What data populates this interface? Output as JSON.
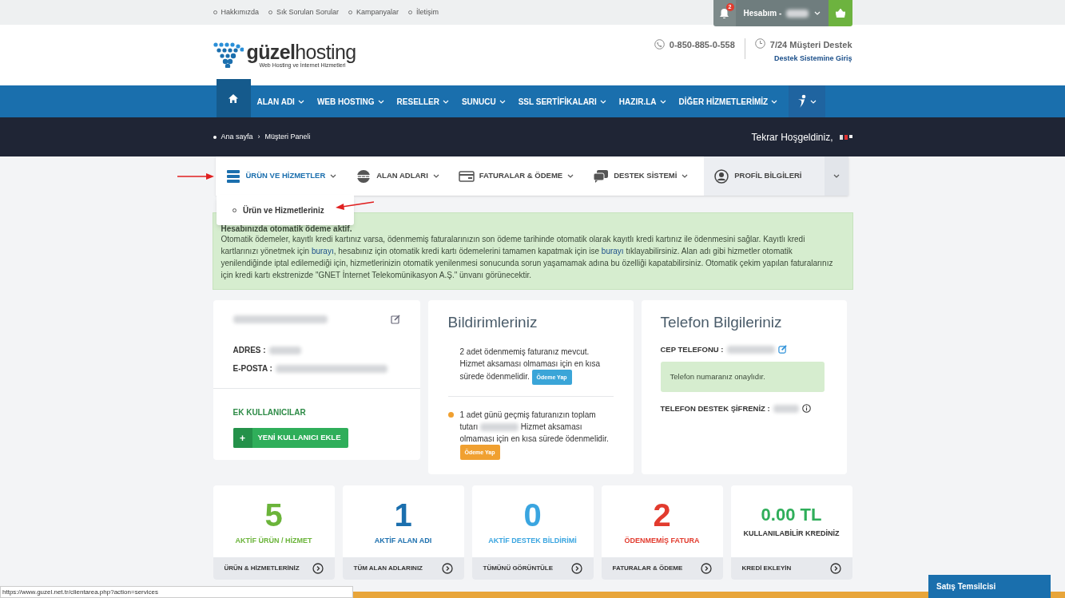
{
  "top_links": [
    "Hakkımızda",
    "Sık Sorulan Sorular",
    "Kampanyalar",
    "İletişim"
  ],
  "account": {
    "notification_count": "2",
    "label": "Hesabım -"
  },
  "logo": {
    "part1": "güzel",
    "part2": "hosting",
    "tagline": "Web Hosting ve İnternet Hizmetleri"
  },
  "contact": {
    "phone": "0-850-885-0-558",
    "support_title": "7/24 Müşteri Destek",
    "support_link": "Destek Sistemine Giriş"
  },
  "nav": [
    {
      "kind": "home",
      "selected": true
    },
    {
      "kind": "text",
      "label": "ALAN ADI",
      "selected": false
    },
    {
      "kind": "text",
      "label": "WEB HOSTING",
      "selected": false
    },
    {
      "kind": "text",
      "label": "RESELLER",
      "selected": false
    },
    {
      "kind": "text",
      "label": "SUNUCU",
      "selected": false
    },
    {
      "kind": "text",
      "label": "SSL SERTİFİKALARI",
      "selected": false
    },
    {
      "kind": "text",
      "label": "HAZIR.LA",
      "selected": false
    },
    {
      "kind": "text",
      "label": "DİĞER HİZMETLERİMİZ",
      "selected": false
    },
    {
      "kind": "figure",
      "selected": false
    }
  ],
  "breadcrumb": [
    "Ana sayfa",
    "Müşteri Paneli"
  ],
  "breadcrumb_separator": "›",
  "welcome": "Tekrar Hoşgeldiniz,",
  "panel_tabs": [
    {
      "kind": "services",
      "label": "ÜRÜN VE HİZMETLER",
      "selected": true
    },
    {
      "kind": "domains",
      "label": "ALAN ADLARI",
      "selected": false
    },
    {
      "kind": "billing",
      "label": "FATURALAR & ÖDEME",
      "selected": false
    },
    {
      "kind": "support",
      "label": "DESTEK SİSTEMİ",
      "selected": false
    },
    {
      "kind": "profile",
      "label": "PROFİL BİLGİLERİ",
      "selected": false
    }
  ],
  "dropdown": [
    "Ürün ve Hizmetleriniz"
  ],
  "alert": {
    "title": "Hesabınızda otomatik ödeme aktif.",
    "segments": [
      {
        "kind": "text",
        "text": "Otomatik ödemeler, kayıtlı kredi kartınız varsa, ödenmemiş faturalarınızın son ödeme tarihinde otomatik olarak kayıtlı kredi kartınız ile ödenmesini sağlar. Kayıtlı kredi kartlarınızı yönetmek için "
      },
      {
        "kind": "link",
        "text": "burayı"
      },
      {
        "kind": "text",
        "text": ", hesabınız için otomatik kredi kartı ödemelerini tamamen kapatmak için ise "
      },
      {
        "kind": "link",
        "text": "burayı"
      },
      {
        "kind": "text",
        "text": " tıklayabilirsiniz. Alan adı gibi hizmetler otomatik yenilendiğinde iptal edilemediği için, hizmetlerinizin otomatik yenilenmesi sonucunda sorun yaşamamak adına bu özelliği kapatabilirsiniz. Otomatik çekim yapılan faturalarınız için kredi kartı ekstrenizde \"GNET İnternet Telekomünikasyon A.Ş.\" ünvanı görünecektir."
      }
    ]
  },
  "profile": {
    "address_label": "ADRES :",
    "email_label": "E-POSTA :",
    "extra_users": "EK KULLANICILAR",
    "add_button": "YENİ KULLANICI EKLE",
    "add_icon": "+"
  },
  "notifications": {
    "title": "Bildirimleriniz",
    "items": [
      {
        "dot": false,
        "color": "#3aa5d8",
        "before": "2 adet ödenmemiş faturanız mevcut. Hizmet aksaması olmaması için en kısa sürede ödenmelidir.",
        "button": "Ödeme Yap"
      },
      {
        "dot": true,
        "color": "#f0a030",
        "before": "1 adet günü geçmiş faturanızın toplam tutarı",
        "after": "Hizmet aksaması olmaması için en kısa sürede ödenmelidir.",
        "button": "Ödeme Yap"
      }
    ]
  },
  "phone": {
    "title": "Telefon Bilgileriniz",
    "mobile_label": "CEP TELEFONU :",
    "verified": "Telefon numaranız onaylıdır.",
    "password_label": "TELEFON DESTEK ŞİFRENİZ :"
  },
  "stats": [
    {
      "value": "5",
      "label": "AKTİF ÜRÜN / HİZMET",
      "color": "#6bb43a",
      "link": "ÜRÜN & HİZMETLERİNİZ"
    },
    {
      "value": "1",
      "label": "AKTİF ALAN ADI",
      "color": "#1b6fae",
      "link": "TÜM ALAN ADLARINIZ"
    },
    {
      "value": "0",
      "label": "AKTİF DESTEK BİLDİRİMİ",
      "color": "#3aa5e0",
      "link": "TÜMÜNÜ GÖRÜNTÜLE"
    },
    {
      "value": "2",
      "label": "ÖDENMEMİŞ FATURA",
      "color": "#e23b2e",
      "link": "FATURALAR & ÖDEME"
    },
    {
      "value": "0.00 TL",
      "label": "KULLANILABİLİR KREDİNİZ",
      "color": "#2fae5a",
      "link": "KREDİ EKLEYİN"
    }
  ],
  "status_url": "https://www.guzel.net.tr/clientarea.php?action=services",
  "sales_button": "Satış Temsilcisi"
}
